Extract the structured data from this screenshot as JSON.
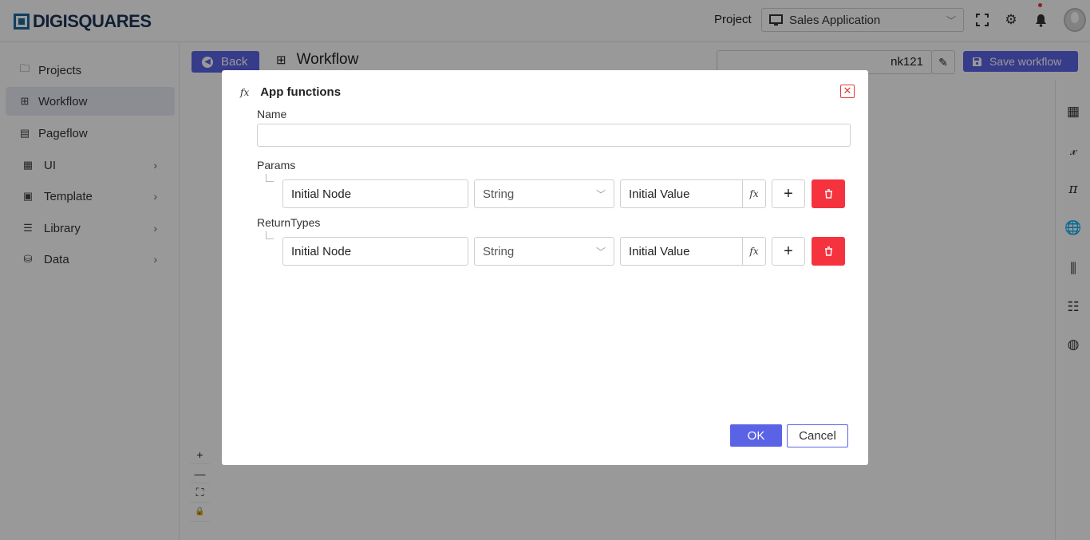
{
  "app": {
    "logo_text": "DIGISQUARES"
  },
  "topbar": {
    "project_label": "Project",
    "project_value": "Sales Application",
    "icons": [
      "fullscreen-icon",
      "gear-icon",
      "bell-icon",
      "avatar"
    ]
  },
  "sidebar": {
    "items": [
      {
        "label": "Projects",
        "icon": "folder-icon"
      },
      {
        "label": "Workflow",
        "icon": "workflow-icon",
        "active": true
      },
      {
        "label": "Pageflow",
        "icon": "document-icon"
      },
      {
        "label": "UI",
        "icon": "ui-grid-icon",
        "has_children": true
      },
      {
        "label": "Template",
        "icon": "template-icon",
        "has_children": true
      },
      {
        "label": "Library",
        "icon": "library-icon",
        "has_children": true
      },
      {
        "label": "Data",
        "icon": "database-icon",
        "has_children": true
      }
    ]
  },
  "workspace": {
    "back_label": "Back",
    "title": "Workflow",
    "name_value": "nk121",
    "save_label": "Save workflow"
  },
  "right_rail": {
    "icons": [
      "grid-icon",
      "function-x-icon",
      "pi-icon",
      "globe-function-icon",
      "sliders-icon",
      "numbered-list-icon",
      "globe-icon"
    ]
  },
  "zoom_controls": [
    "+",
    "—",
    "⛶",
    "🔒"
  ],
  "modal": {
    "title": "App functions",
    "title_icon": "fx",
    "name_label": "Name",
    "name_value": "",
    "params_label": "Params",
    "params": [
      {
        "node": "Initial Node",
        "type": "String",
        "value": "Initial Value"
      }
    ],
    "return_types_label": "ReturnTypes",
    "return_types": [
      {
        "node": "Initial Node",
        "type": "String",
        "value": "Initial Value"
      }
    ],
    "ok_label": "OK",
    "cancel_label": "Cancel",
    "colors": {
      "primary": "#5a63e6",
      "danger": "#f5333f"
    }
  }
}
